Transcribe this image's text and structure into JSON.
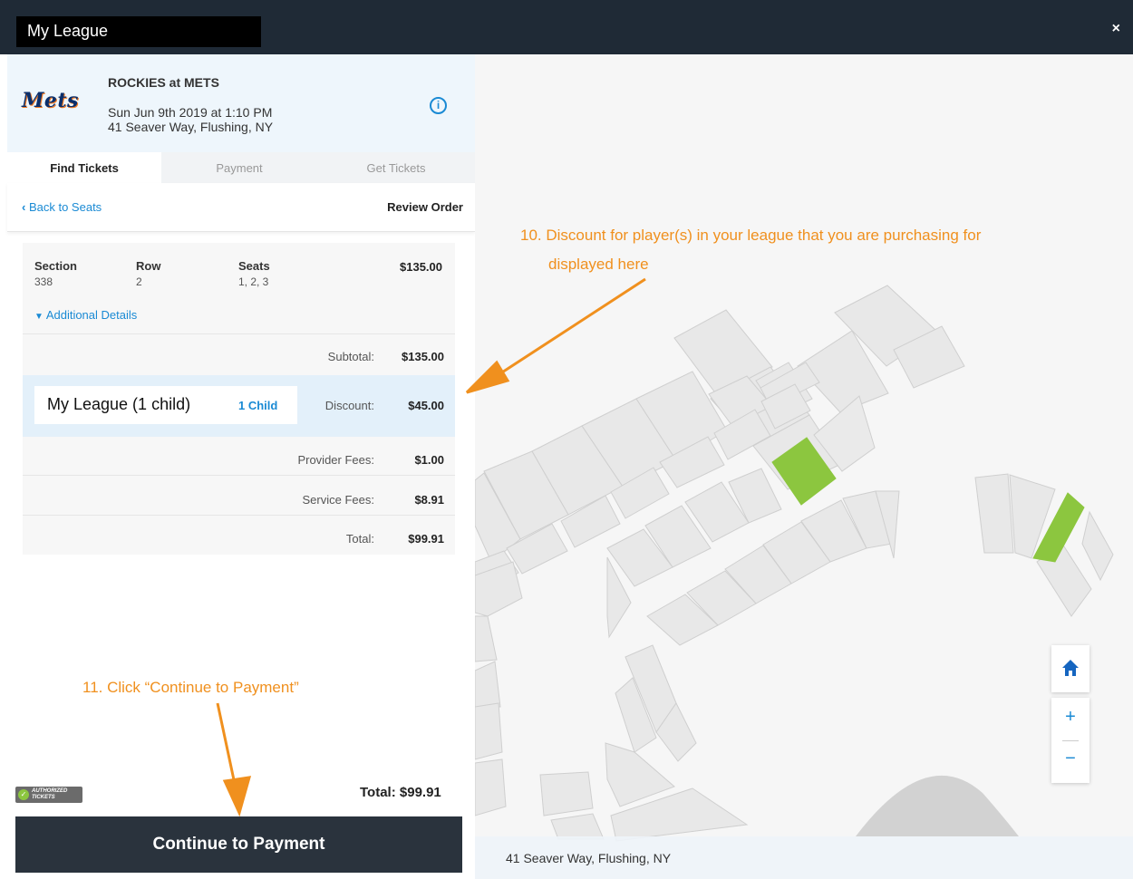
{
  "window": {
    "title": "My League",
    "close_glyph": "×"
  },
  "event": {
    "team_logo": "Mets",
    "title": "ROCKIES at METS",
    "datetime": "Sun Jun 9th 2019 at 1:10 PM",
    "venue": "41 Seaver Way, Flushing, NY",
    "info_icon": "info-icon"
  },
  "tabs": [
    "Find Tickets",
    "Payment",
    "Get Tickets"
  ],
  "subnav": {
    "back": "Back to Seats",
    "title": "Review Order"
  },
  "seat": {
    "section_label": "Section",
    "section": "338",
    "row_label": "Row",
    "row": "2",
    "seats_label": "Seats",
    "seats": "1, 2, 3",
    "price": "$135.00"
  },
  "additional_details": "Additional Details",
  "summary": {
    "subtotal_label": "Subtotal:",
    "subtotal": "$135.00",
    "league": "My League (1 child)",
    "league_tag": "1 Child",
    "discount_label": "Discount:",
    "discount": "$45.00",
    "provider_label": "Provider Fees:",
    "provider": "$1.00",
    "service_label": "Service Fees:",
    "service": "$8.91",
    "total_label": "Total:",
    "total": "$99.91"
  },
  "footer": {
    "badge": "AUTHORIZED TICKETS",
    "total": "Total:  $99.91",
    "continue": "Continue to Payment"
  },
  "map": {
    "address": "41 Seaver Way, Flushing, NY",
    "home_icon": "home-icon",
    "zoom_in": "+",
    "zoom_out": "−"
  },
  "annotations": {
    "step10_line1": "10. Discount for player(s) in your league that you are purchasing for",
    "step10_line2": "displayed here",
    "step11": "11. Click “Continue to Payment”"
  },
  "colors": {
    "accent": "#1a8ad4",
    "annotation": "#f0901e",
    "selected_section": "#8cc63f",
    "dark": "#1f2a36"
  }
}
